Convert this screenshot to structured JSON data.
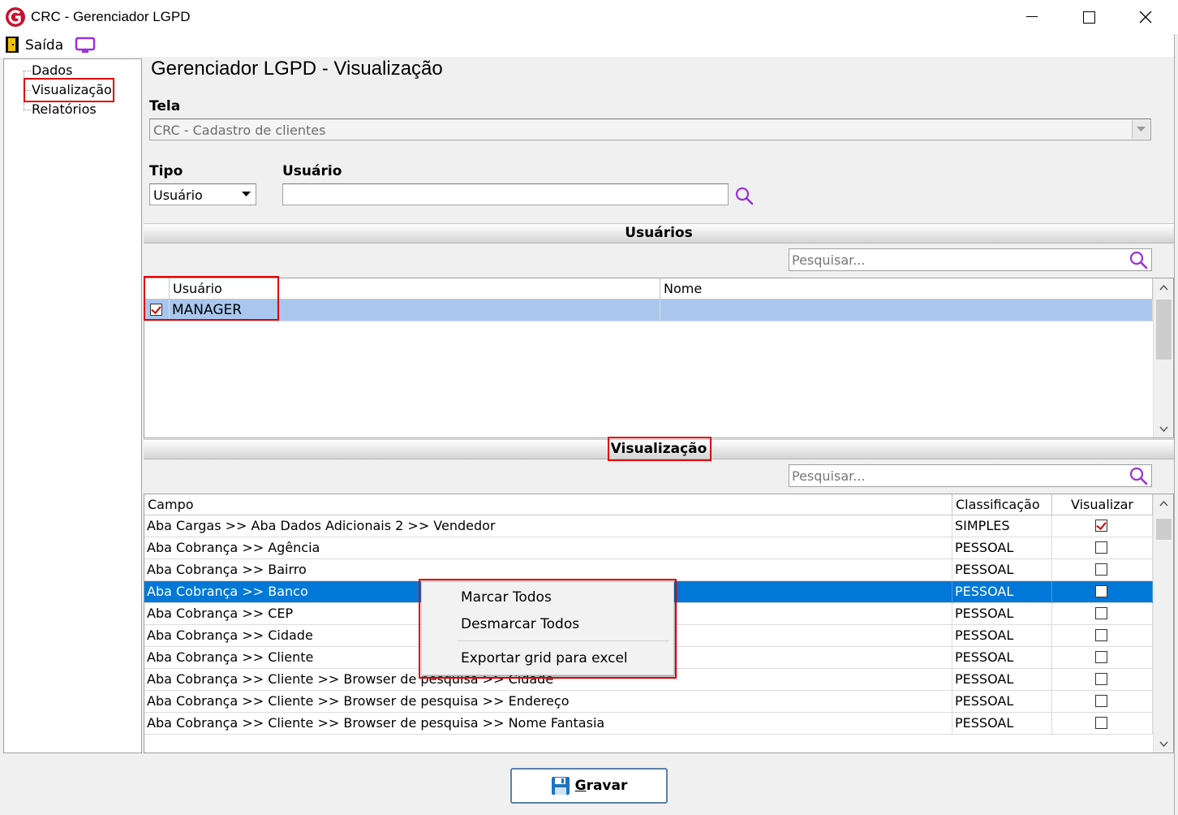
{
  "window": {
    "title": "CRC - Gerenciador LGPD",
    "minimize": "–",
    "maximize": "☐",
    "close": "✕"
  },
  "menu": {
    "exit_label": "Saída"
  },
  "tree": {
    "items": [
      {
        "label": "Dados"
      },
      {
        "label": "Visualização"
      },
      {
        "label": "Relatórios"
      }
    ]
  },
  "main": {
    "title": "Gerenciador LGPD - Visualização",
    "tela_label": "Tela",
    "tela_value": "CRC - Cadastro de clientes",
    "tipo_label": "Tipo",
    "tipo_value": "Usuário",
    "usuario_label": "Usuário",
    "usuario_value": ""
  },
  "users_section": {
    "title": "Usuários",
    "search_placeholder": "Pesquisar...",
    "columns": [
      "Usuário",
      "Nome"
    ],
    "rows": [
      {
        "checked": true,
        "usuario": "MANAGER",
        "nome": ""
      }
    ]
  },
  "view_section": {
    "title": "Visualização",
    "search_placeholder": "Pesquisar...",
    "columns": [
      "Campo",
      "Classificação",
      "Visualizar"
    ],
    "rows": [
      {
        "campo": "Aba Cargas >> Aba Dados Adicionais 2 >> Vendedor",
        "classificacao": "SIMPLES",
        "visualizar": true,
        "selected": false
      },
      {
        "campo": "Aba Cobrança >> Agência",
        "classificacao": "PESSOAL",
        "visualizar": false,
        "selected": false
      },
      {
        "campo": "Aba Cobrança >> Bairro",
        "classificacao": "PESSOAL",
        "visualizar": false,
        "selected": false
      },
      {
        "campo": "Aba Cobrança >> Banco",
        "classificacao": "PESSOAL",
        "visualizar": false,
        "selected": true
      },
      {
        "campo": "Aba Cobrança >> CEP",
        "classificacao": "PESSOAL",
        "visualizar": false,
        "selected": false
      },
      {
        "campo": "Aba Cobrança >> Cidade",
        "classificacao": "PESSOAL",
        "visualizar": false,
        "selected": false
      },
      {
        "campo": "Aba Cobrança >> Cliente",
        "classificacao": "PESSOAL",
        "visualizar": false,
        "selected": false
      },
      {
        "campo": "Aba Cobrança >> Cliente >> Browser de pesquisa >> Cidade",
        "classificacao": "PESSOAL",
        "visualizar": false,
        "selected": false
      },
      {
        "campo": "Aba Cobrança >> Cliente >> Browser de pesquisa >> Endereço",
        "classificacao": "PESSOAL",
        "visualizar": false,
        "selected": false
      },
      {
        "campo": "Aba Cobrança >> Cliente >> Browser de pesquisa >> Nome Fantasia",
        "classificacao": "PESSOAL",
        "visualizar": false,
        "selected": false
      }
    ]
  },
  "context_menu": {
    "items": [
      "Marcar Todos",
      "Desmarcar Todos",
      "Exportar grid para excel"
    ]
  },
  "save_button": {
    "label": "Gravar"
  },
  "colors": {
    "selection": "#0078d7",
    "highlight_border": "#e00000",
    "search_icon": "#8a2be2"
  }
}
